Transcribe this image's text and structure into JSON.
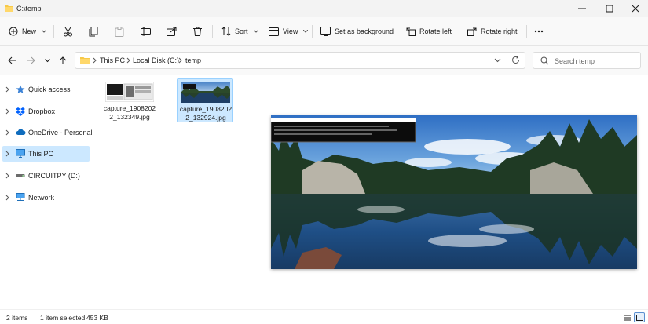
{
  "window": {
    "title": "C:\\temp",
    "controls": {
      "minimize": "minimize-icon",
      "maximize": "maximize-icon",
      "close": "close-icon"
    }
  },
  "commandbar": {
    "new_label": "New",
    "sort_label": "Sort",
    "view_label": "View",
    "set_background_label": "Set as background",
    "rotate_left_label": "Rotate left",
    "rotate_right_label": "Rotate right"
  },
  "address": {
    "crumbs": [
      "This PC",
      "Local Disk (C:)",
      "temp"
    ]
  },
  "search": {
    "placeholder": "Search temp"
  },
  "navpane": {
    "items": [
      {
        "label": "Quick access",
        "icon": "star-icon"
      },
      {
        "label": "Dropbox",
        "icon": "dropbox-icon"
      },
      {
        "label": "OneDrive - Personal",
        "icon": "cloud-icon"
      },
      {
        "label": "This PC",
        "icon": "computer-icon",
        "selected": true
      },
      {
        "label": "CIRCUITPY (D:)",
        "icon": "drive-icon"
      },
      {
        "label": "Network",
        "icon": "network-icon"
      }
    ]
  },
  "files": [
    {
      "name": "capture_19082022_132349.jpg",
      "selected": false
    },
    {
      "name": "capture_19082022_132924.jpg",
      "selected": true
    }
  ],
  "status": {
    "items": "2 items",
    "selected": "1 item selected",
    "size": "453 KB"
  },
  "colors": {
    "accent": "#0067c0",
    "selection": "#cce8ff",
    "folder": "#f7c948"
  }
}
